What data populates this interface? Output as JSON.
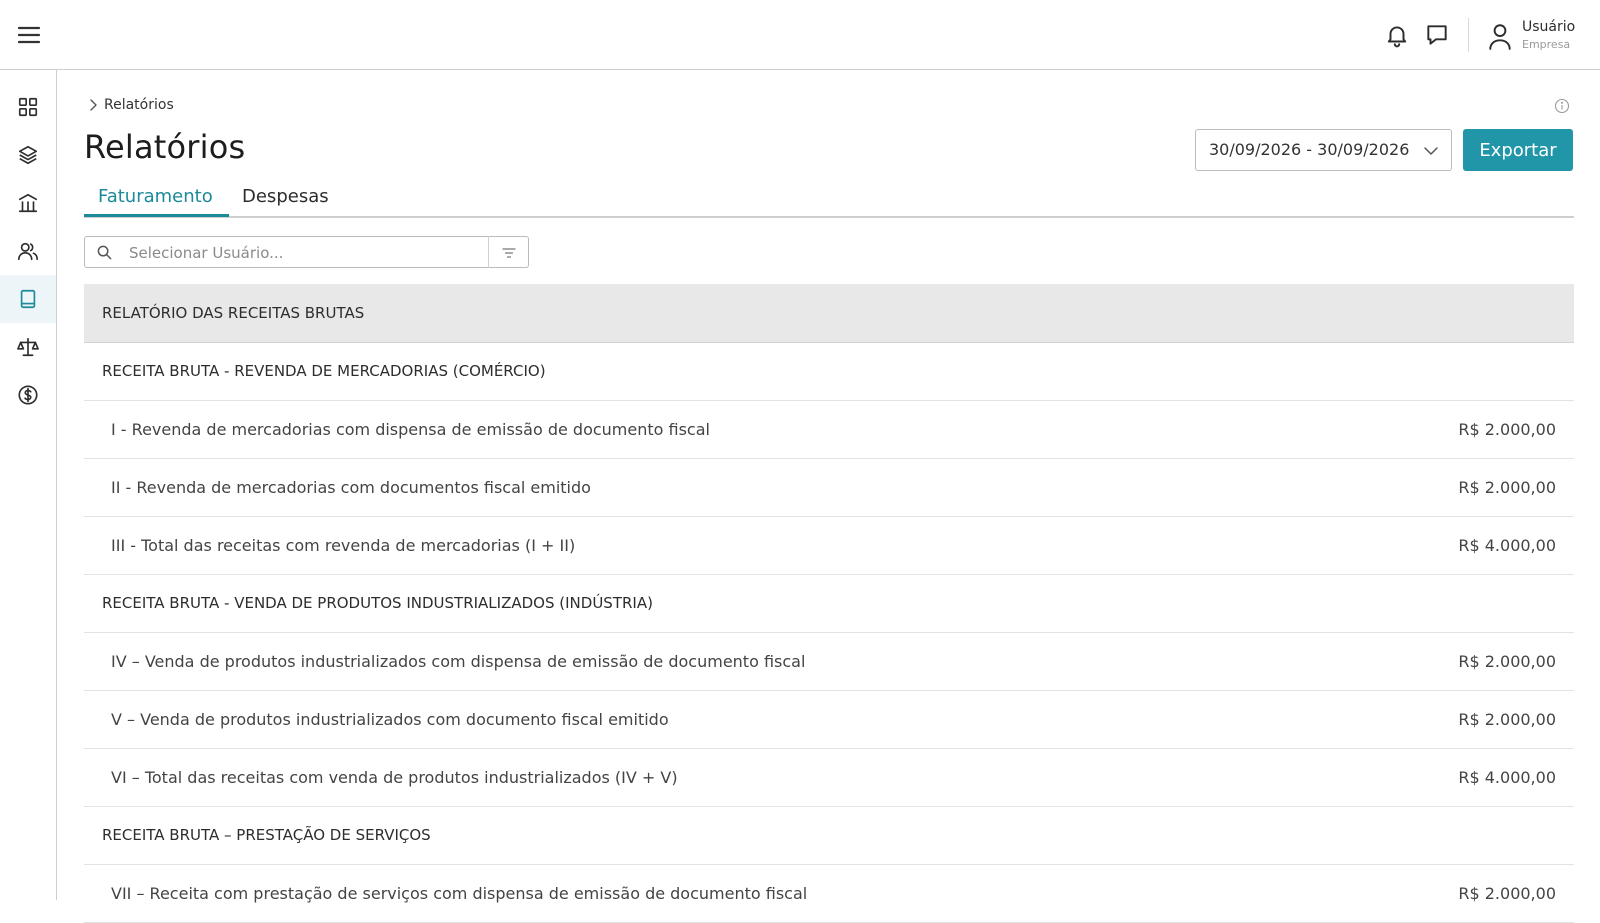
{
  "header": {
    "user_name": "Usuário",
    "user_company": "Empresa"
  },
  "icons": {
    "menu": "hamburger-icon",
    "notifications": "bell-icon",
    "messages": "chat-icon",
    "user": "user-icon"
  },
  "sidebar": {
    "items": [
      {
        "icon": "dashboard-grid-icon",
        "active": false
      },
      {
        "icon": "layers-icon",
        "active": false
      },
      {
        "icon": "bank-icon",
        "active": false
      },
      {
        "icon": "users-icon",
        "active": false
      },
      {
        "icon": "book-icon",
        "active": true
      },
      {
        "icon": "scale-icon",
        "active": false
      },
      {
        "icon": "dollar-circle-icon",
        "active": false
      }
    ]
  },
  "breadcrumb": {
    "current": "Relatórios"
  },
  "page": {
    "title": "Relatórios",
    "date_range": "30/09/2026 - 30/09/2026",
    "export_label": "Exportar"
  },
  "tabs": [
    {
      "label": "Faturamento",
      "active": true
    },
    {
      "label": "Despesas",
      "active": false
    }
  ],
  "search": {
    "placeholder": "Selecionar Usuário..."
  },
  "report": {
    "title": "RELATÓRIO DAS RECEITAS BRUTAS",
    "rows": [
      {
        "type": "section",
        "label": "RECEITA BRUTA - REVENDA DE MERCADORIAS (COMÉRCIO)",
        "value": ""
      },
      {
        "type": "item",
        "label": "I - Revenda de mercadorias com dispensa de emissão de documento fiscal",
        "value": "R$ 2.000,00"
      },
      {
        "type": "item",
        "label": "II - Revenda de mercadorias com documentos fiscal emitido",
        "value": "R$ 2.000,00"
      },
      {
        "type": "item",
        "label": "III - Total das receitas com revenda de mercadorias (I + II)",
        "value": "R$ 4.000,00"
      },
      {
        "type": "section",
        "label": "RECEITA BRUTA - VENDA DE PRODUTOS INDUSTRIALIZADOS (INDÚSTRIA)",
        "value": ""
      },
      {
        "type": "item",
        "label": "IV – Venda de produtos industrializados com dispensa de emissão de documento fiscal",
        "value": "R$ 2.000,00"
      },
      {
        "type": "item",
        "label": "V – Venda de produtos industrializados com documento fiscal emitido",
        "value": "R$ 2.000,00"
      },
      {
        "type": "item",
        "label": "VI – Total das receitas com venda de produtos industrializados (IV + V)",
        "value": "R$ 4.000,00"
      },
      {
        "type": "section",
        "label": "RECEITA BRUTA – PRESTAÇÃO DE SERVIÇOS",
        "value": ""
      },
      {
        "type": "item",
        "label": "VII – Receita com prestação de serviços com dispensa de emissão de documento fiscal",
        "value": "R$ 2.000,00"
      }
    ]
  },
  "colors": {
    "accent": "#1c8a9a",
    "button": "#2196a8",
    "header_bg": "#e8e8e8",
    "sidebar_active_bg": "#eef5f8"
  }
}
